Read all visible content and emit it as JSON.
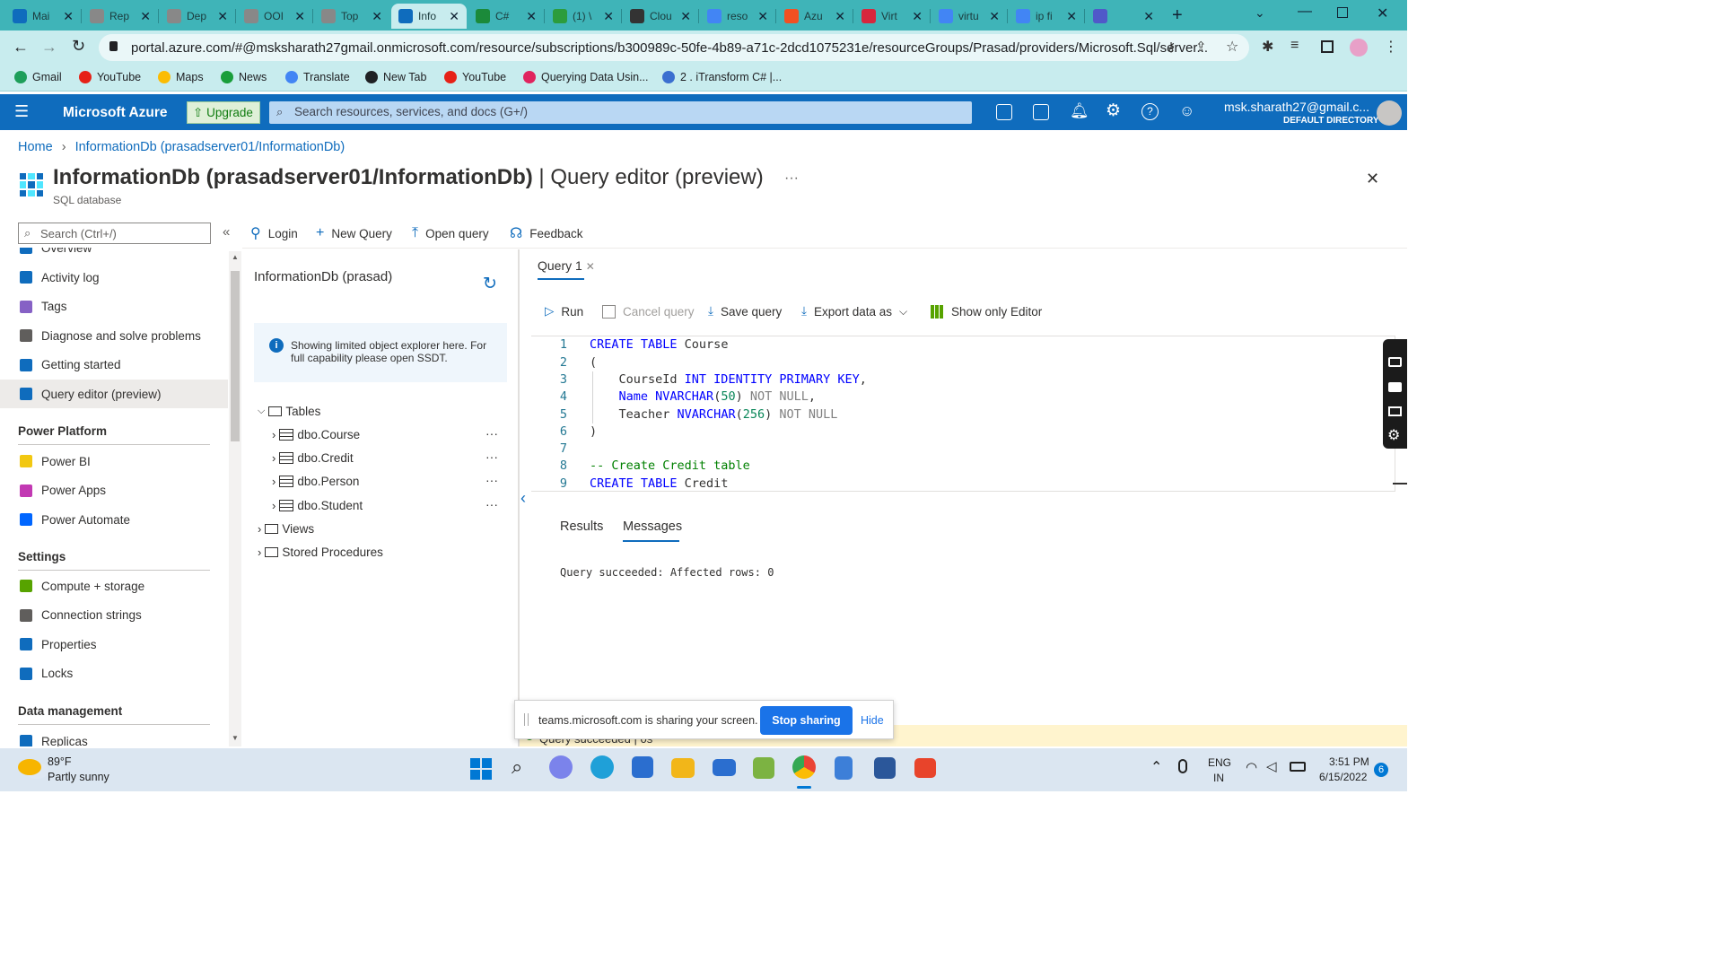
{
  "browser": {
    "tabs": [
      {
        "label": "Mai",
        "color": "#0f6cbd"
      },
      {
        "label": "Rep",
        "color": "#888"
      },
      {
        "label": "Dep",
        "color": "#888"
      },
      {
        "label": "OOI",
        "color": "#888"
      },
      {
        "label": "Top",
        "color": "#888"
      },
      {
        "label": "Info",
        "color": "#0f6cbd"
      },
      {
        "label": "C#",
        "color": "#1b8a3a"
      },
      {
        "label": "(1) \\",
        "color": "#2c9c3c"
      },
      {
        "label": "Clou",
        "color": "#333"
      },
      {
        "label": "reso",
        "color": "#4285f4"
      },
      {
        "label": "Azu",
        "color": "#f25022"
      },
      {
        "label": "Virt",
        "color": "#d7263d"
      },
      {
        "label": "virtu",
        "color": "#4285f4"
      },
      {
        "label": "ip fi",
        "color": "#4285f4"
      },
      {
        "label": "",
        "color": "#5059c9"
      }
    ],
    "url": "portal.azure.com/#@msksharath27gmail.onmicrosoft.com/resource/subscriptions/b300989c-50fe-4b89-a71c-2dcd1075231e/resourceGroups/Prasad/providers/Microsoft.Sql/server...",
    "bookmarks": [
      {
        "label": "Gmail",
        "color": "#1e9e5a"
      },
      {
        "label": "YouTube",
        "color": "#e62117"
      },
      {
        "label": "Maps",
        "color": "#fbbc04"
      },
      {
        "label": "News",
        "color": "#1a9e3b"
      },
      {
        "label": "Translate",
        "color": "#4285f4"
      },
      {
        "label": "New Tab",
        "color": "#202124"
      },
      {
        "label": "YouTube",
        "color": "#e62117"
      },
      {
        "label": "Querying Data Usin...",
        "color": "#e0245e"
      },
      {
        "label": "2 . iTransform C# |...",
        "color": "#3b6fd0"
      }
    ]
  },
  "azure": {
    "brand": "Microsoft Azure",
    "upgrade": "Upgrade",
    "search_placeholder": "Search resources, services, and docs (G+/)",
    "account_email": "msk.sharath27@gmail.c...",
    "account_dir": "DEFAULT DIRECTORY"
  },
  "breadcrumb": {
    "home": "Home",
    "current": "InformationDb (prasadserver01/InformationDb)"
  },
  "page": {
    "title_bold": "InformationDb (prasadserver01/InformationDb)",
    "title_rest": " | Query editor (preview)",
    "subtitle": "SQL database",
    "more": "···",
    "close": "✕"
  },
  "sidebar": {
    "search_placeholder": "Search (Ctrl+/)",
    "collapse": "«",
    "partial_item": "Overview",
    "items": [
      {
        "label": "Activity log",
        "color": "#0f6cbd"
      },
      {
        "label": "Tags",
        "color": "#8661c5"
      },
      {
        "label": "Diagnose and solve problems",
        "color": "#605e5c"
      },
      {
        "label": "Getting started",
        "color": "#0f6cbd"
      },
      {
        "label": "Query editor (preview)",
        "color": "#0f6cbd"
      }
    ],
    "section_power": "Power Platform",
    "power_items": [
      {
        "label": "Power BI",
        "color": "#f2c811"
      },
      {
        "label": "Power Apps",
        "color": "#c239b3"
      },
      {
        "label": "Power Automate",
        "color": "#0066ff"
      }
    ],
    "section_settings": "Settings",
    "settings_items": [
      {
        "label": "Compute + storage",
        "color": "#57a300"
      },
      {
        "label": "Connection strings",
        "color": "#605e5c"
      },
      {
        "label": "Properties",
        "color": "#0f6cbd"
      },
      {
        "label": "Locks",
        "color": "#0f6cbd"
      }
    ],
    "section_data": "Data management",
    "data_items": [
      {
        "label": "Replicas",
        "color": "#0f6cbd"
      }
    ]
  },
  "toolbar": {
    "login": "Login",
    "new_query": "New Query",
    "open_query": "Open query",
    "feedback": "Feedback"
  },
  "explorer": {
    "title": "InformationDb (prasad)",
    "info": "Showing limited object explorer here. For full capability please open SSDT.",
    "tables": "Tables",
    "table_items": [
      "dbo.Course",
      "dbo.Credit",
      "dbo.Person",
      "dbo.Student"
    ],
    "views": "Views",
    "procedures": "Stored Procedures"
  },
  "editor": {
    "tab": "Query 1",
    "run": "Run",
    "cancel": "Cancel query",
    "save": "Save query",
    "export": "Export data as",
    "show_only": "Show only Editor",
    "line_numbers": [
      "1",
      "2",
      "3",
      "4",
      "5",
      "6",
      "7",
      "8",
      "9"
    ],
    "results_tab": "Results",
    "messages_tab": "Messages",
    "message": "Query succeeded: Affected rows: 0",
    "status": "Query succeeded | 0s"
  },
  "share_bar": {
    "text": "teams.microsoft.com is sharing your screen.",
    "stop": "Stop sharing",
    "hide": "Hide"
  },
  "taskbar": {
    "temp": "89°F",
    "weather": "Partly sunny",
    "lang1": "ENG",
    "lang2": "IN",
    "time": "3:51 PM",
    "date": "6/15/2022",
    "notif": "6"
  }
}
